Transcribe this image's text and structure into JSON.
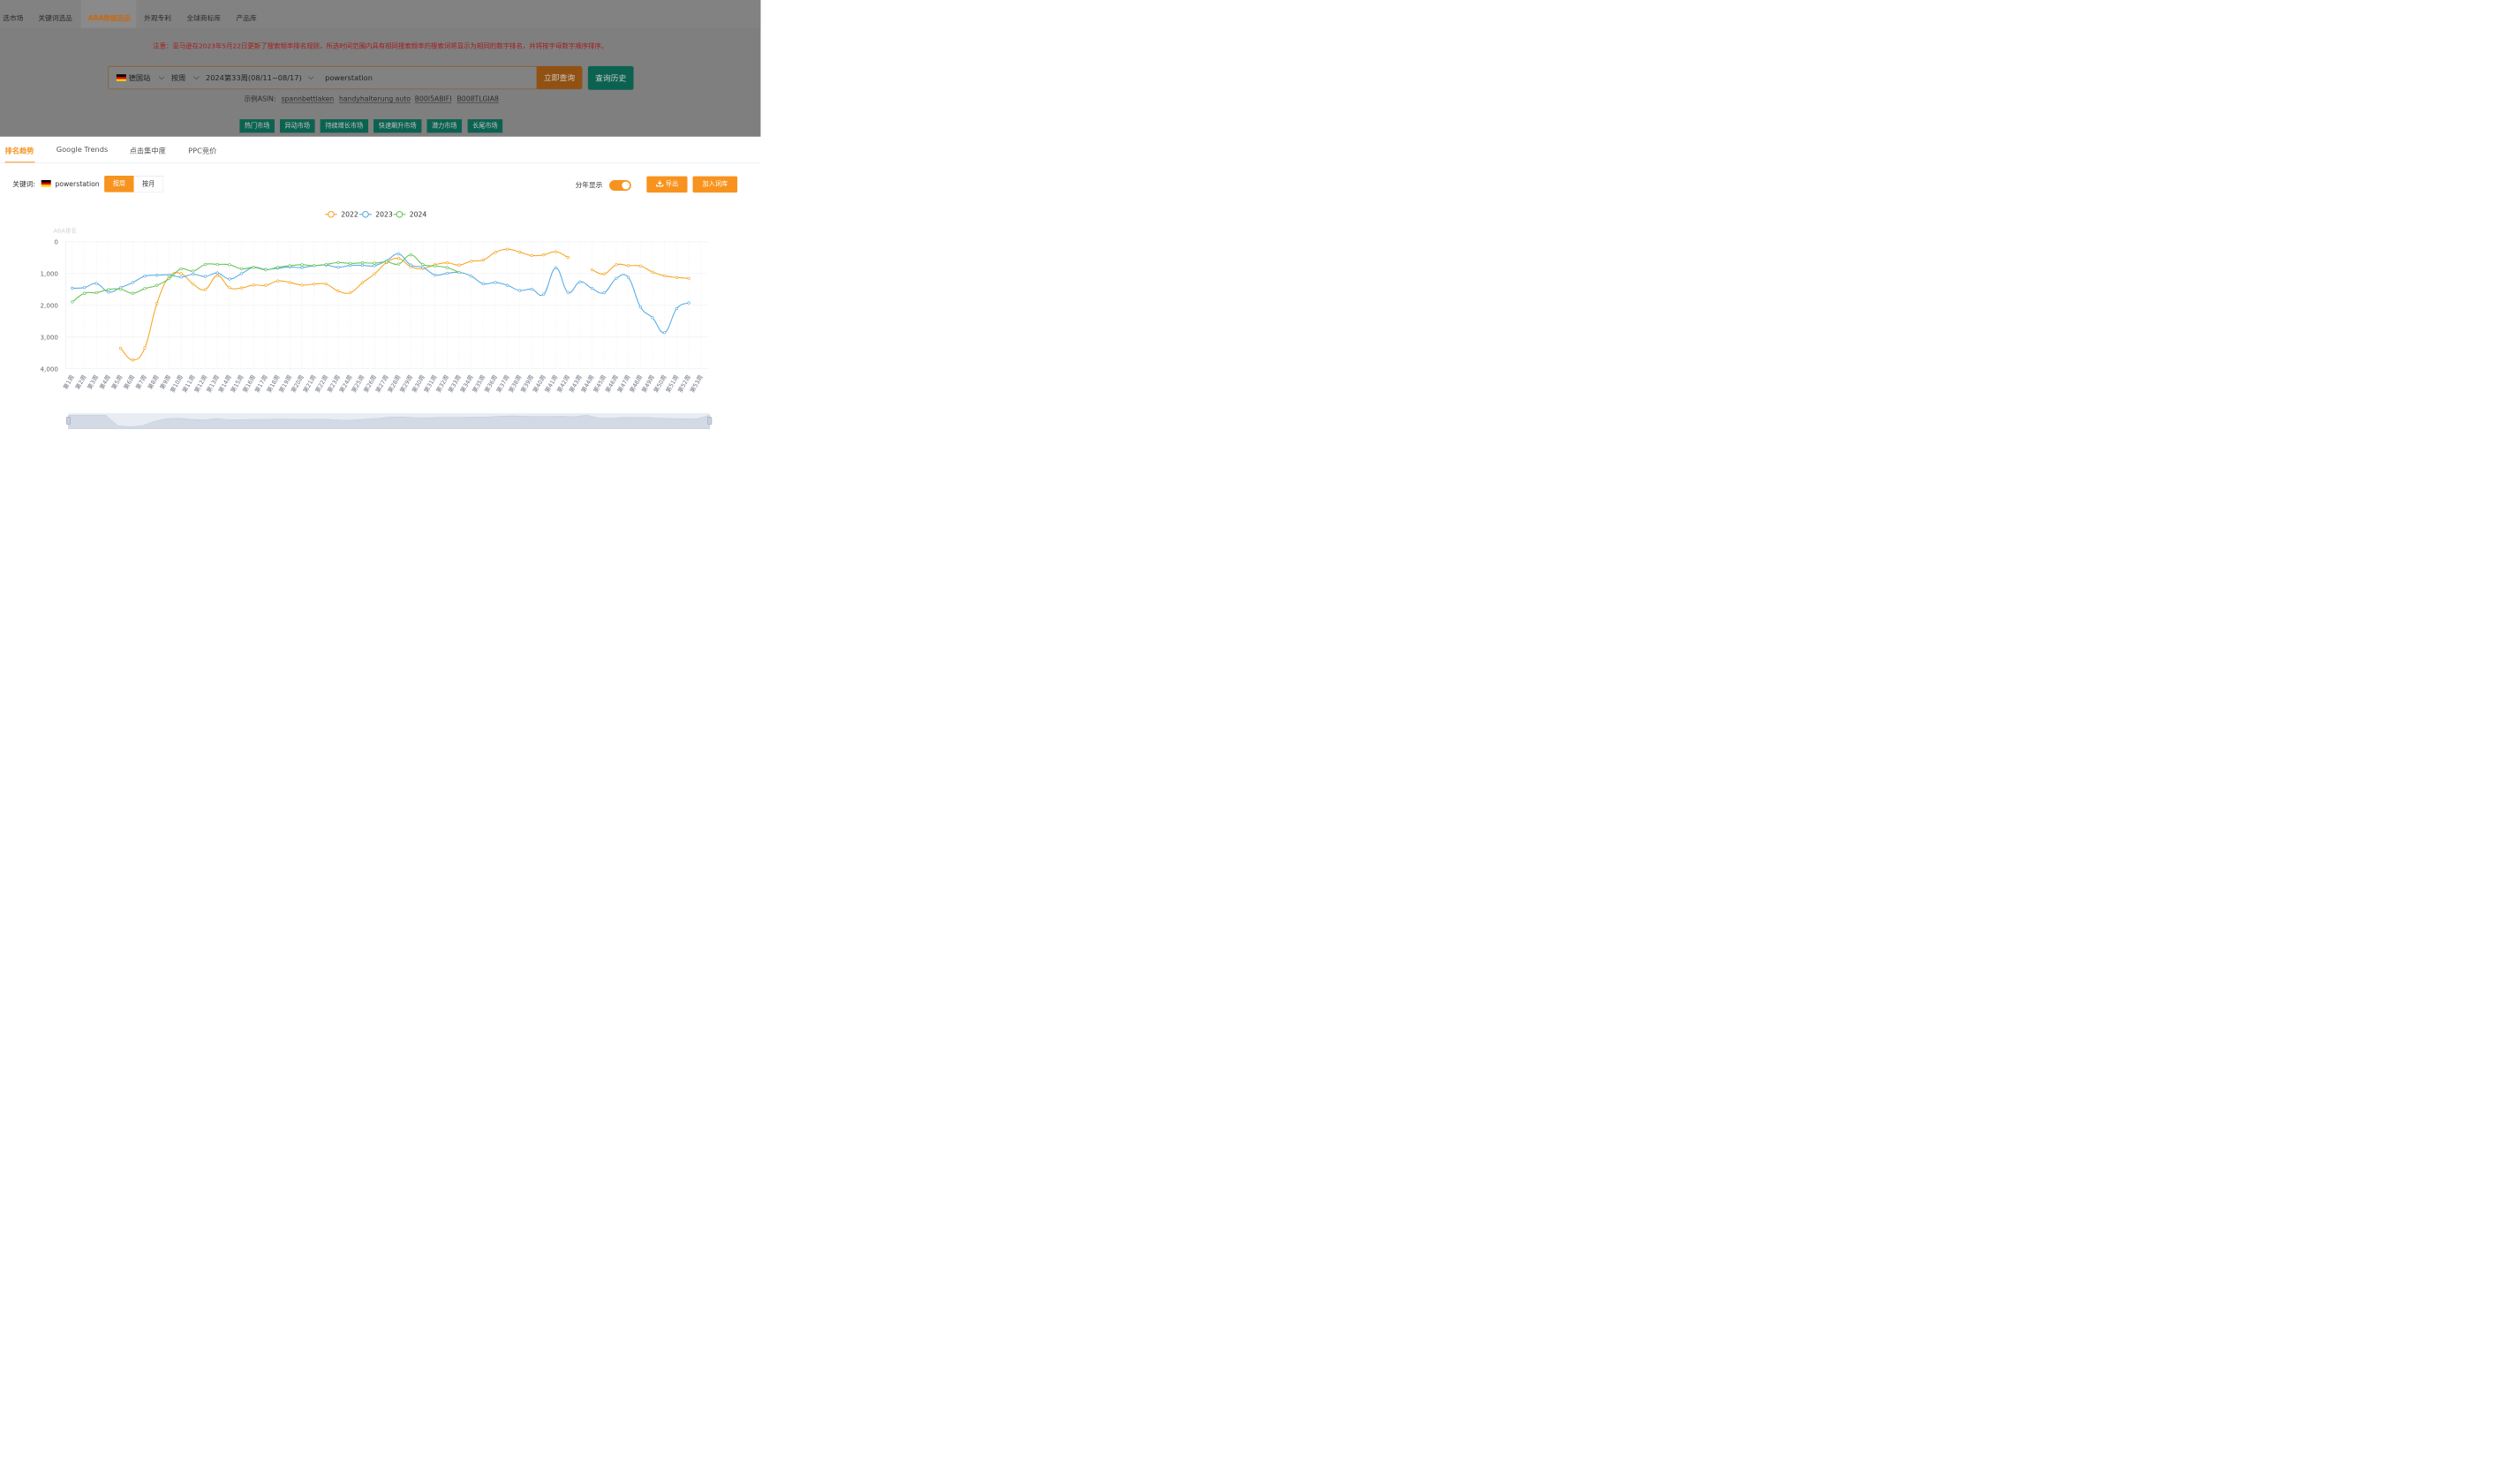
{
  "nav": {
    "items": [
      "选市场",
      "关键词选品",
      "ABA数据选品",
      "外观专利",
      "全球商标库",
      "产品库"
    ],
    "active": 2
  },
  "notice": "注意：亚马逊在2023年5月22日更新了搜索频率排名规则，所选时间范围内具有相同搜索频率的搜索词将显示为相同的数字排名，并将按字母数字顺序排序。",
  "search": {
    "site": "德国站",
    "period_type": "按周",
    "period": "2024第33周(08/11~08/17)",
    "keyword": "powerstation",
    "query_button": "立即查询",
    "history_button": "查询历史"
  },
  "examples": {
    "label": "示例ASIN:",
    "items": [
      "spannbettlaken",
      "handyhalterung auto",
      "B00I5ABIFI",
      "B008TLGIA8"
    ]
  },
  "markets": [
    "热门市场",
    "异动市场",
    "持续增长市场",
    "快速飙升市场",
    "潜力市场",
    "长尾市场"
  ],
  "tabs": [
    "排名趋势",
    "Google Trends",
    "点击集中度",
    "PPC竞价"
  ],
  "controls": {
    "keyword_label": "关键词:",
    "keyword": "powerstation",
    "by_week": "按周",
    "by_month": "按月",
    "year_split_label": "分年显示",
    "year_split_on": true,
    "export_button": "导出",
    "add_button": "加入词库"
  },
  "chart_data": {
    "type": "line",
    "ylabel": "ABA排名",
    "y_inverted": true,
    "ylim": [
      0,
      4000
    ],
    "yticks": [
      0,
      1000,
      2000,
      3000,
      4000
    ],
    "ytick_labels": [
      "0",
      "1,000",
      "2,000",
      "3,000",
      "4,000"
    ],
    "grid": true,
    "legend_position": "top-center",
    "categories": [
      "第1周",
      "第2周",
      "第3周",
      "第4周",
      "第5周",
      "第6周",
      "第7周",
      "第8周",
      "第9周",
      "第10周",
      "第11周",
      "第12周",
      "第13周",
      "第14周",
      "第15周",
      "第16周",
      "第17周",
      "第18周",
      "第19周",
      "第20周",
      "第21周",
      "第22周",
      "第23周",
      "第24周",
      "第25周",
      "第26周",
      "第27周",
      "第28周",
      "第29周",
      "第30周",
      "第31周",
      "第32周",
      "第33周",
      "第34周",
      "第35周",
      "第36周",
      "第37周",
      "第38周",
      "第39周",
      "第40周",
      "第41周",
      "第42周",
      "第43周",
      "第44周",
      "第45周",
      "第46周",
      "第47周",
      "第48周",
      "第49周",
      "第50周",
      "第51周",
      "第52周",
      "第53周"
    ],
    "series": [
      {
        "name": "2022",
        "color": "#f7a829",
        "values": [
          null,
          null,
          null,
          null,
          3350,
          3720,
          3340,
          1940,
          1100,
          1000,
          1330,
          1500,
          1060,
          1440,
          1450,
          1360,
          1370,
          1230,
          1280,
          1360,
          1330,
          1330,
          1550,
          1600,
          1290,
          1010,
          650,
          520,
          780,
          840,
          720,
          660,
          730,
          610,
          570,
          330,
          230,
          320,
          430,
          410,
          310,
          490,
          null,
          880,
          1010,
          720,
          750,
          760,
          950,
          1070,
          1120,
          1150,
          null
        ]
      },
      {
        "name": "2023",
        "color": "#5aaee6",
        "values": [
          1460,
          1440,
          1310,
          1580,
          1440,
          1280,
          1080,
          1050,
          1040,
          1110,
          1020,
          1090,
          980,
          1170,
          1000,
          800,
          870,
          830,
          790,
          810,
          750,
          730,
          800,
          740,
          740,
          750,
          590,
          380,
          730,
          800,
          1040,
          990,
          960,
          1080,
          1320,
          1280,
          1370,
          1530,
          1490,
          1650,
          820,
          1590,
          1260,
          1470,
          1600,
          1150,
          1120,
          2050,
          2390,
          2860,
          2100,
          1920,
          null
        ]
      },
      {
        "name": "2024",
        "color": "#6ac65a",
        "values": [
          1890,
          1620,
          1600,
          1500,
          1490,
          1620,
          1470,
          1370,
          1160,
          850,
          920,
          710,
          710,
          720,
          850,
          800,
          880,
          800,
          750,
          720,
          750,
          710,
          650,
          680,
          660,
          670,
          630,
          700,
          410,
          710,
          760,
          810,
          960,
          null,
          null,
          null,
          null,
          null,
          null,
          null,
          null,
          null,
          null,
          null,
          null,
          null,
          null,
          null,
          null,
          null,
          null,
          null,
          null
        ]
      }
    ]
  }
}
